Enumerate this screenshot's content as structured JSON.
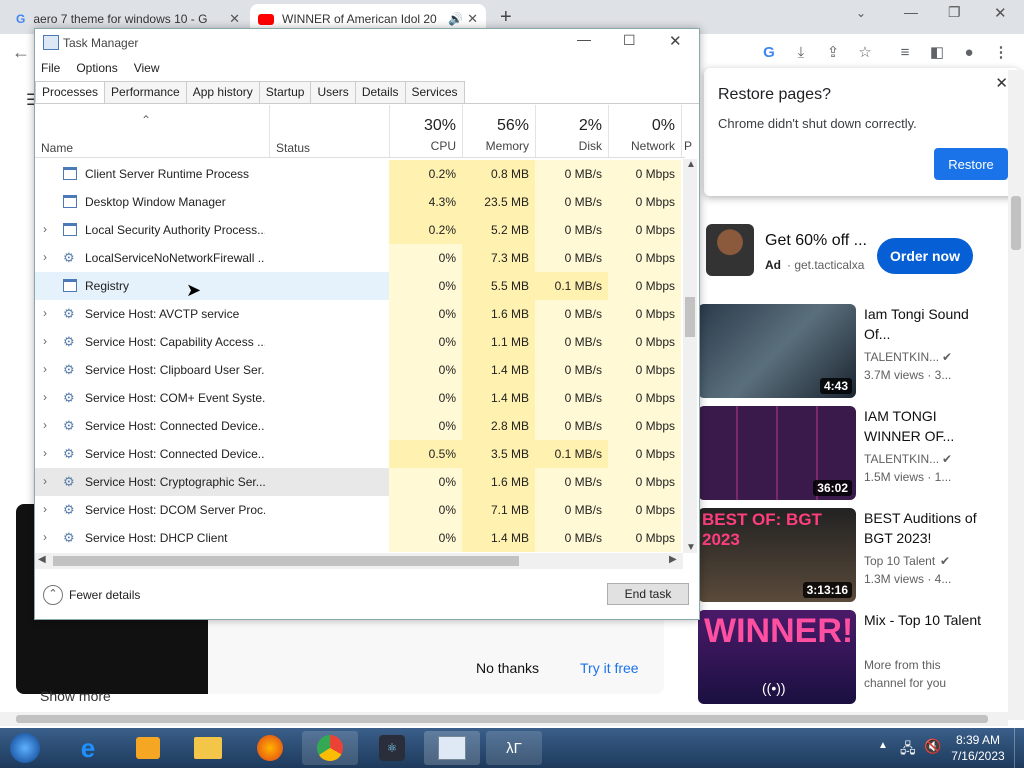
{
  "browser": {
    "tabs": [
      {
        "title": "aero 7 theme for windows 10 - G",
        "favicon": "google-icon"
      },
      {
        "title": "WINNER of American Idol 20",
        "favicon": "youtube-icon"
      }
    ],
    "new_tab": "+"
  },
  "restore_popup": {
    "title": "Restore pages?",
    "message": "Chrome didn't shut down correctly.",
    "button": "Restore"
  },
  "ad": {
    "title": "Get 60% off ...",
    "badge": "Ad",
    "domain": "· get.tacticalxa",
    "button": "Order now"
  },
  "videos": [
    {
      "title": "Iam Tongi Sound Of...",
      "channel": "TALENTKIN...",
      "views": "3.7M views · 3...",
      "duration": "4:43"
    },
    {
      "title": "IAM TONGI WINNER OF...",
      "channel": "TALENTKIN...",
      "views": "1.5M views · 1...",
      "duration": "36:02"
    },
    {
      "title": "BEST Auditions of BGT 2023!",
      "channel": "Top 10 Talent",
      "views": "1.3M views · 4...",
      "duration": "3:13:16",
      "thumb_text": "BEST OF: BGT 2023"
    },
    {
      "title": "Mix - Top 10 Talent",
      "channel": "More from this channel for you",
      "views": "",
      "duration": "",
      "thumb_text": "WINNER!"
    }
  ],
  "promo": {
    "no_thanks": "No thanks",
    "try_free": "Try it free",
    "show_more": "Show more"
  },
  "task_manager": {
    "title": "Task Manager",
    "menu": [
      "File",
      "Options",
      "View"
    ],
    "tabs": [
      "Processes",
      "Performance",
      "App history",
      "Startup",
      "Users",
      "Details",
      "Services"
    ],
    "columns": {
      "name": "Name",
      "status": "Status",
      "cpu_pct": "30%",
      "cpu": "CPU",
      "mem_pct": "56%",
      "mem": "Memory",
      "disk_pct": "2%",
      "disk": "Disk",
      "net_pct": "0%",
      "net": "Network",
      "extra": "P"
    },
    "rows": [
      {
        "name": "Client Server Runtime Process",
        "cpu": "0.2%",
        "mem": "0.8 MB",
        "disk": "0 MB/s",
        "net": "0 Mbps",
        "expand": false,
        "icon": "window-icon"
      },
      {
        "name": "Desktop Window Manager",
        "cpu": "4.3%",
        "mem": "23.5 MB",
        "disk": "0 MB/s",
        "net": "0 Mbps",
        "expand": false,
        "icon": "window-icon"
      },
      {
        "name": "Local Security Authority Process...",
        "cpu": "0.2%",
        "mem": "5.2 MB",
        "disk": "0 MB/s",
        "net": "0 Mbps",
        "expand": true,
        "icon": "window-icon"
      },
      {
        "name": "LocalServiceNoNetworkFirewall ...",
        "cpu": "0%",
        "mem": "7.3 MB",
        "disk": "0 MB/s",
        "net": "0 Mbps",
        "expand": true,
        "icon": "gear-icon"
      },
      {
        "name": "Registry",
        "cpu": "0%",
        "mem": "5.5 MB",
        "disk": "0.1 MB/s",
        "net": "0 Mbps",
        "expand": false,
        "icon": "window-icon"
      },
      {
        "name": "Service Host: AVCTP service",
        "cpu": "0%",
        "mem": "1.6 MB",
        "disk": "0 MB/s",
        "net": "0 Mbps",
        "expand": true,
        "icon": "gear-icon"
      },
      {
        "name": "Service Host: Capability Access ...",
        "cpu": "0%",
        "mem": "1.1 MB",
        "disk": "0 MB/s",
        "net": "0 Mbps",
        "expand": true,
        "icon": "gear-icon"
      },
      {
        "name": "Service Host: Clipboard User Ser...",
        "cpu": "0%",
        "mem": "1.4 MB",
        "disk": "0 MB/s",
        "net": "0 Mbps",
        "expand": true,
        "icon": "gear-icon"
      },
      {
        "name": "Service Host: COM+ Event Syste...",
        "cpu": "0%",
        "mem": "1.4 MB",
        "disk": "0 MB/s",
        "net": "0 Mbps",
        "expand": true,
        "icon": "gear-icon"
      },
      {
        "name": "Service Host: Connected Device...",
        "cpu": "0%",
        "mem": "2.8 MB",
        "disk": "0 MB/s",
        "net": "0 Mbps",
        "expand": true,
        "icon": "gear-icon"
      },
      {
        "name": "Service Host: Connected Device...",
        "cpu": "0.5%",
        "mem": "3.5 MB",
        "disk": "0.1 MB/s",
        "net": "0 Mbps",
        "expand": true,
        "icon": "gear-icon"
      },
      {
        "name": "Service Host: Cryptographic Ser...",
        "cpu": "0%",
        "mem": "1.6 MB",
        "disk": "0 MB/s",
        "net": "0 Mbps",
        "expand": true,
        "icon": "gear-icon"
      },
      {
        "name": "Service Host: DCOM Server Proc...",
        "cpu": "0%",
        "mem": "7.1 MB",
        "disk": "0 MB/s",
        "net": "0 Mbps",
        "expand": true,
        "icon": "gear-icon"
      },
      {
        "name": "Service Host: DHCP Client",
        "cpu": "0%",
        "mem": "1.4 MB",
        "disk": "0 MB/s",
        "net": "0 Mbps",
        "expand": true,
        "icon": "gear-icon"
      }
    ],
    "fewer_details": "Fewer details",
    "end_task": "End task"
  },
  "taskbar": {
    "time": "8:39 AM",
    "date": "7/16/2023"
  },
  "colors": {
    "heat_light": "#fff9d6",
    "heat_med": "#fff1b0",
    "accent": "#1a73e8",
    "yt_red": "#ff0000"
  }
}
